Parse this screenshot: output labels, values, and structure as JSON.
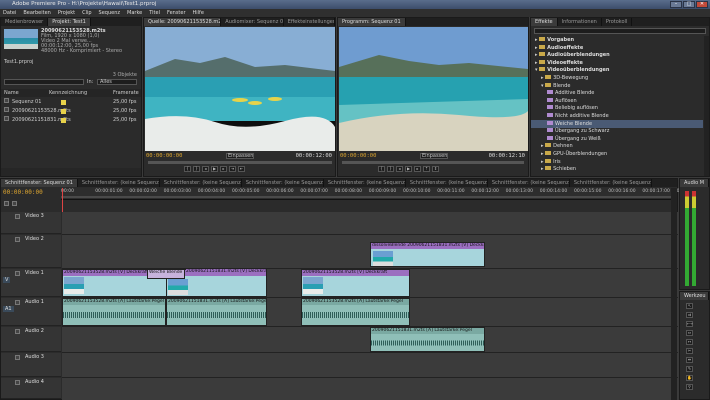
{
  "app": {
    "title": "Adobe Premiere Pro - H:\\Projekte\\Hawaii\\Test1.prproj",
    "win": [
      "–",
      "□",
      "✕"
    ]
  },
  "menu": [
    "Datei",
    "Bearbeiten",
    "Projekt",
    "Clip",
    "Sequenz",
    "Marke",
    "Titel",
    "Fenster",
    "Hilfe"
  ],
  "project": {
    "tabs": [
      "Medienbrowser",
      "Projekt: Test1"
    ],
    "file": "20090621153528.m2ts",
    "info": [
      "Film, 1920 x 1080 (1,0)",
      "Video 2 Mal verwe...",
      "00:00:12:00, 25,00 fps",
      "48000 Hz - Komprimiert - Stereo",
      "Audio 2..."
    ],
    "proj_name": "Test1.prproj",
    "count": "3 Objekte",
    "search_label": "In:",
    "search_value": "Alles",
    "cols": [
      "Name",
      "Kennzeichnung",
      "Framerate"
    ],
    "items": [
      {
        "name": "Sequenz 01",
        "fps": "25,00 fps"
      },
      {
        "name": "20090621153528.m2ts",
        "fps": "25,00 fps"
      },
      {
        "name": "20090621151831.m2ts",
        "fps": "25,00 fps"
      }
    ]
  },
  "source": {
    "tabs": [
      "Quelle: 20090621153528.m2ts",
      "Audiomixer: Sequenz 01",
      "Effekteinstellungen"
    ],
    "tc_in": "00:00:00:00",
    "fit": "Einpassen",
    "tc_dur": "00:00:12:00"
  },
  "program": {
    "tabs": [
      "Programm: Sequenz 01"
    ],
    "tc_in": "00:00:00:00",
    "fit": "Einpassen",
    "tc_dur": "00:00:12:10"
  },
  "effects": {
    "tabs": [
      "Effekte",
      "Informationen",
      "Protokoll"
    ],
    "items": [
      {
        "label": "Vorgaben",
        "bold": true,
        "indent": 0,
        "kind": "folder"
      },
      {
        "label": "Audioeffekte",
        "bold": true,
        "indent": 0,
        "kind": "folder"
      },
      {
        "label": "Audioüberblendungen",
        "bold": true,
        "indent": 0,
        "kind": "folder"
      },
      {
        "label": "Videoeffekte",
        "bold": true,
        "indent": 0,
        "kind": "folder"
      },
      {
        "label": "Videoüberblendungen",
        "bold": true,
        "indent": 0,
        "kind": "open"
      },
      {
        "label": "3D-Bewegung",
        "bold": false,
        "indent": 1,
        "kind": "folder"
      },
      {
        "label": "Blende",
        "bold": false,
        "indent": 1,
        "kind": "open"
      },
      {
        "label": "Additive Blende",
        "bold": false,
        "indent": 2,
        "kind": "item"
      },
      {
        "label": "Auflösen",
        "bold": false,
        "indent": 2,
        "kind": "item"
      },
      {
        "label": "Beliebig auflösen",
        "bold": false,
        "indent": 2,
        "kind": "item"
      },
      {
        "label": "Nicht additive Blende",
        "bold": false,
        "indent": 2,
        "kind": "item"
      },
      {
        "label": "Weiche Blende",
        "bold": false,
        "indent": 2,
        "kind": "item",
        "selected": true
      },
      {
        "label": "Übergang zu Schwarz",
        "bold": false,
        "indent": 2,
        "kind": "item"
      },
      {
        "label": "Übergang zu Weiß",
        "bold": false,
        "indent": 2,
        "kind": "item"
      },
      {
        "label": "Dehnen",
        "bold": false,
        "indent": 1,
        "kind": "folder"
      },
      {
        "label": "GPU-Überblendungen",
        "bold": false,
        "indent": 1,
        "kind": "folder"
      },
      {
        "label": "Iris",
        "bold": false,
        "indent": 1,
        "kind": "folder"
      },
      {
        "label": "Schieben",
        "bold": false,
        "indent": 1,
        "kind": "folder"
      }
    ]
  },
  "timeline": {
    "tabs": [
      "Schnittfenster: Sequenz 01",
      "Schnittfenster: (keine Sequenzen)",
      "Schnittfenster: (keine Sequenzen)",
      "Schnittfenster: (keine Sequenzen)",
      "Schnittfenster: (keine Sequenzen)",
      "Schnittfenster: (keine Sequenzen)",
      "Schnittfenster: (keine Sequenzen)",
      "Schnittfenster: (keine Sequenzen)"
    ],
    "tc": "00:00:00:00",
    "ruler": [
      "00:00",
      "00:00:01:00",
      "00:00:02:00",
      "00:00:03:00",
      "00:00:04:00",
      "00:00:05:00",
      "00:00:06:00",
      "00:00:07:00",
      "00:00:08:00",
      "00:00:09:00",
      "00:00:10:00",
      "00:00:11:00",
      "00:00:12:00",
      "00:00:13:00",
      "00:00:14:00",
      "00:00:15:00",
      "00:00:16:00",
      "00:00:17:00",
      "00:00:18:00"
    ],
    "tracks": [
      "Video 3",
      "Video 2",
      "Video 1",
      "Audio 1",
      "Audio 2",
      "Audio 3",
      "Audio 4"
    ],
    "side": [
      "V",
      "A1"
    ],
    "clips": {
      "v2": "dissolveBlende 20090621151831.m2ts [V] Deckkraft",
      "v1a": "20090621153528.m2ts [V] Deckkraft",
      "v1t": "Weiche Blende",
      "v1b": "20090621151831.m2ts [V] Deckkraft",
      "v1c": "20090621153528.m2ts [V] Deckkraft",
      "a1a": "20090621153528.m2ts [A] Lautstärke:Pegel",
      "a1b": "20090621151831.m2ts [A] Lautstärke:Pegel",
      "a1c": "20090621153528.m2ts [A] Lautstärke:Pegel",
      "a2": "20090621151831.m2ts [A] Lautstärke:Pegel"
    }
  },
  "audio_master": {
    "tab": "Audio M"
  },
  "tools": {
    "tab": "Werkzeu"
  }
}
